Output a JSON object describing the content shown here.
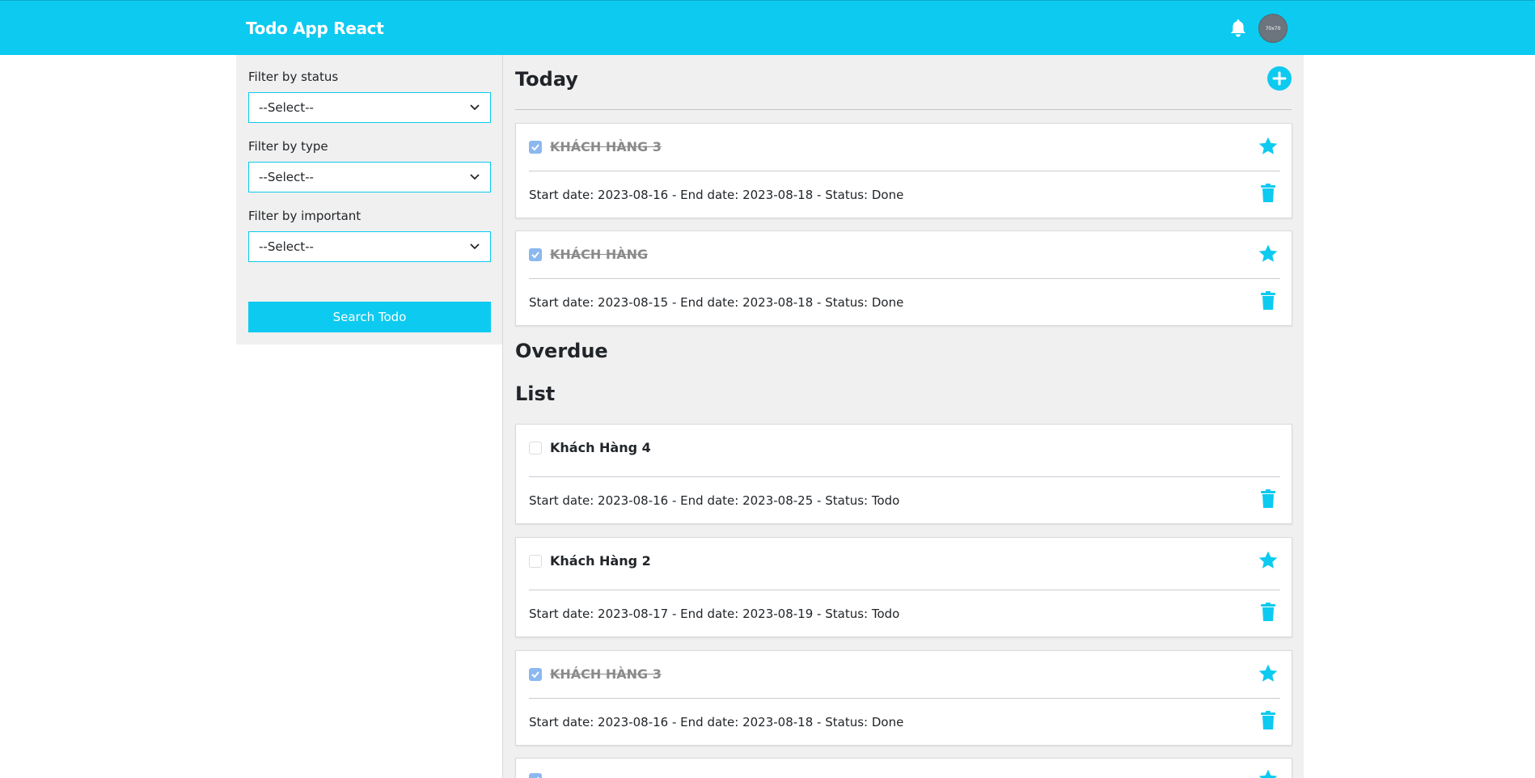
{
  "app": {
    "title": "Todo App React",
    "avatar_text": "70x70",
    "accent_color": "#0dcaf0"
  },
  "header": {
    "icons": [
      "bell-icon",
      "avatar"
    ]
  },
  "sidebar": {
    "filters": [
      {
        "label": "Filter by status",
        "value": "--Select--"
      },
      {
        "label": "Filter by type",
        "value": "--Select--"
      },
      {
        "label": "Filter by important",
        "value": "--Select--"
      }
    ],
    "search_button": "Search Todo"
  },
  "sections": {
    "today": {
      "title": "Today",
      "items": [
        {
          "title": "KHÁCH HÀNG 3",
          "meta": "Start date: 2023-08-16 - End date: 2023-08-18 - Status: Done",
          "checked": true,
          "important": true
        },
        {
          "title": "KHÁCH HÀNG",
          "meta": "Start date: 2023-08-15 - End date: 2023-08-18 - Status: Done",
          "checked": true,
          "important": true
        }
      ]
    },
    "overdue": {
      "title": "Overdue"
    },
    "list": {
      "title": "List",
      "items": [
        {
          "title": "Khách Hàng 4",
          "meta": "Start date: 2023-08-16 - End date: 2023-08-25 - Status: Todo",
          "checked": false,
          "important": false
        },
        {
          "title": "Khách Hàng 2",
          "meta": "Start date: 2023-08-17 - End date: 2023-08-19 - Status: Todo",
          "checked": false,
          "important": true
        },
        {
          "title": "KHÁCH HÀNG 3",
          "meta": "Start date: 2023-08-16 - End date: 2023-08-18 - Status: Done",
          "checked": true,
          "important": true
        }
      ]
    }
  }
}
